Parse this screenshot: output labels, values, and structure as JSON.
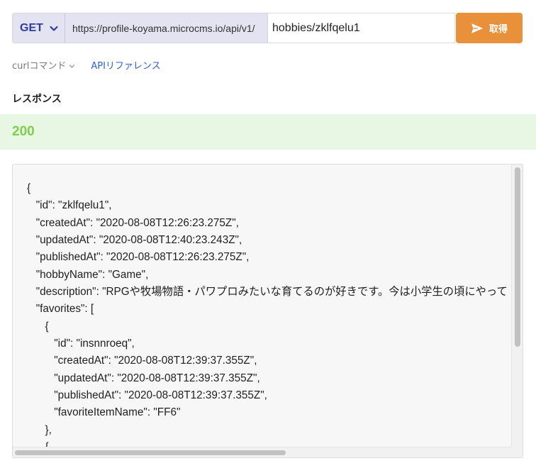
{
  "request": {
    "method": "GET",
    "base_url": "https://profile-koyama.microcms.io/api/v1/",
    "path": "hobbies/zklfqelu1",
    "send_label": "取得"
  },
  "links": {
    "curl_label": "curlコマンド",
    "api_reference_label": "APIリファレンス"
  },
  "response": {
    "heading": "レスポンス",
    "status_code": "200",
    "body_lines": [
      "{",
      "   \"id\": \"zklfqelu1\",",
      "   \"createdAt\": \"2020-08-08T12:26:23.275Z\",",
      "   \"updatedAt\": \"2020-08-08T12:40:23.243Z\",",
      "   \"publishedAt\": \"2020-08-08T12:26:23.275Z\",",
      "   \"hobbyName\": \"Game\",",
      "   \"description\": \"RPGや牧場物語・パワプロみたいな育てるのが好きです。今は小学生の頃にやって",
      "   \"favorites\": [",
      "      {",
      "         \"id\": \"insnnroeq\",",
      "         \"createdAt\": \"2020-08-08T12:39:37.355Z\",",
      "         \"updatedAt\": \"2020-08-08T12:39:37.355Z\",",
      "         \"publishedAt\": \"2020-08-08T12:39:37.355Z\",",
      "         \"favoriteItemName\": \"FF6\"",
      "      },",
      "      {"
    ]
  },
  "colors": {
    "send_button": "#e9913a",
    "method_text": "#2f3b9e",
    "status_success": "#7fcf4f",
    "status_bar_bg": "#e8f6e4",
    "link": "#2b5fd0"
  },
  "icons": {
    "method_dropdown": "chevron-down-icon",
    "send": "send-icon",
    "curl_toggle": "chevron-down-icon"
  }
}
